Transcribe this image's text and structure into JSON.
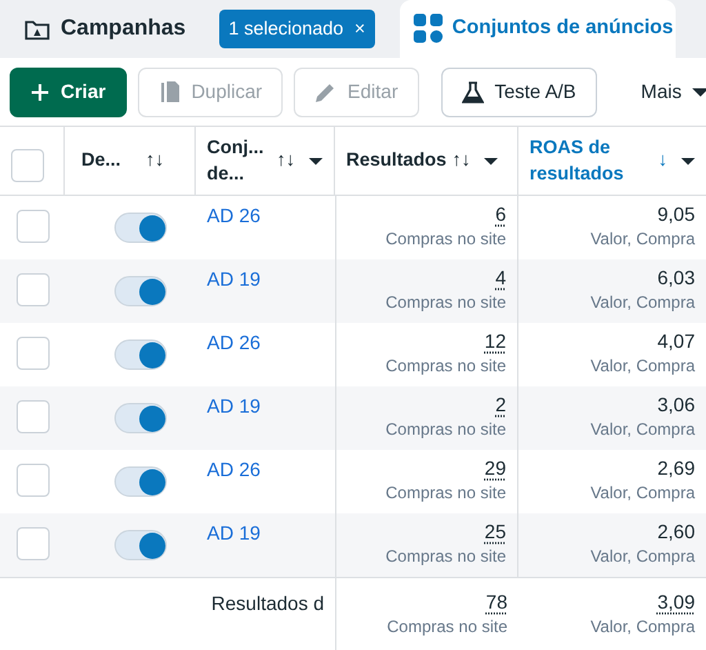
{
  "tabs": [
    {
      "label": "Campanhas",
      "selected": false,
      "badge": {
        "label": "1 selecionado",
        "close": "×"
      }
    },
    {
      "label": "Conjuntos de anúncios",
      "selected": true
    }
  ],
  "toolbar": [
    {
      "label": "Criar",
      "kind": "primary",
      "disabled": false
    },
    {
      "label": "Duplicar",
      "kind": "outline",
      "disabled": true
    },
    {
      "label": "Editar",
      "kind": "outline",
      "disabled": true
    },
    {
      "label": "Teste A/B",
      "kind": "outline",
      "disabled": false
    },
    {
      "label": "Mais",
      "kind": "plain",
      "disabled": false
    }
  ],
  "table": {
    "select_all": {
      "checked": false
    },
    "columns": [
      {
        "label": "De...",
        "sort": "↑↓",
        "menu": false,
        "sorted": false
      },
      {
        "label": "Conj... de...",
        "sort": "↑↓",
        "menu": true,
        "sorted": false
      },
      {
        "label": "Resultados",
        "sort": "↑↓",
        "menu": true,
        "sorted": false
      },
      {
        "label": "ROAS de resultados",
        "sort": "↓",
        "menu": true,
        "sorted": true
      }
    ],
    "rows": [
      {
        "checked": false,
        "on": true,
        "name": "AD 26",
        "results": "6",
        "results_label": "Compras no site",
        "roas": "9,05",
        "roas_label": "Valor, Compra"
      },
      {
        "checked": false,
        "on": true,
        "name": "AD 19",
        "results": "4",
        "results_label": "Compras no site",
        "roas": "6,03",
        "roas_label": "Valor, Compra"
      },
      {
        "checked": false,
        "on": true,
        "name": "AD 26",
        "results": "12",
        "results_label": "Compras no site",
        "roas": "4,07",
        "roas_label": "Valor, Compra"
      },
      {
        "checked": false,
        "on": true,
        "name": "AD 19",
        "results": "2",
        "results_label": "Compras no site",
        "roas": "3,06",
        "roas_label": "Valor, Compra"
      },
      {
        "checked": false,
        "on": true,
        "name": "AD 26",
        "results": "29",
        "results_label": "Compras no site",
        "roas": "2,69",
        "roas_label": "Valor, Compra"
      },
      {
        "checked": false,
        "on": true,
        "name": "AD 19",
        "results": "25",
        "results_label": "Compras no site",
        "roas": "2,60",
        "roas_label": "Valor, Compra"
      }
    ],
    "footer": {
      "label": "Resultados d",
      "results": "78",
      "results_label": "Compras no site",
      "roas": "3,09",
      "roas_label": "Valor, Compra"
    }
  }
}
